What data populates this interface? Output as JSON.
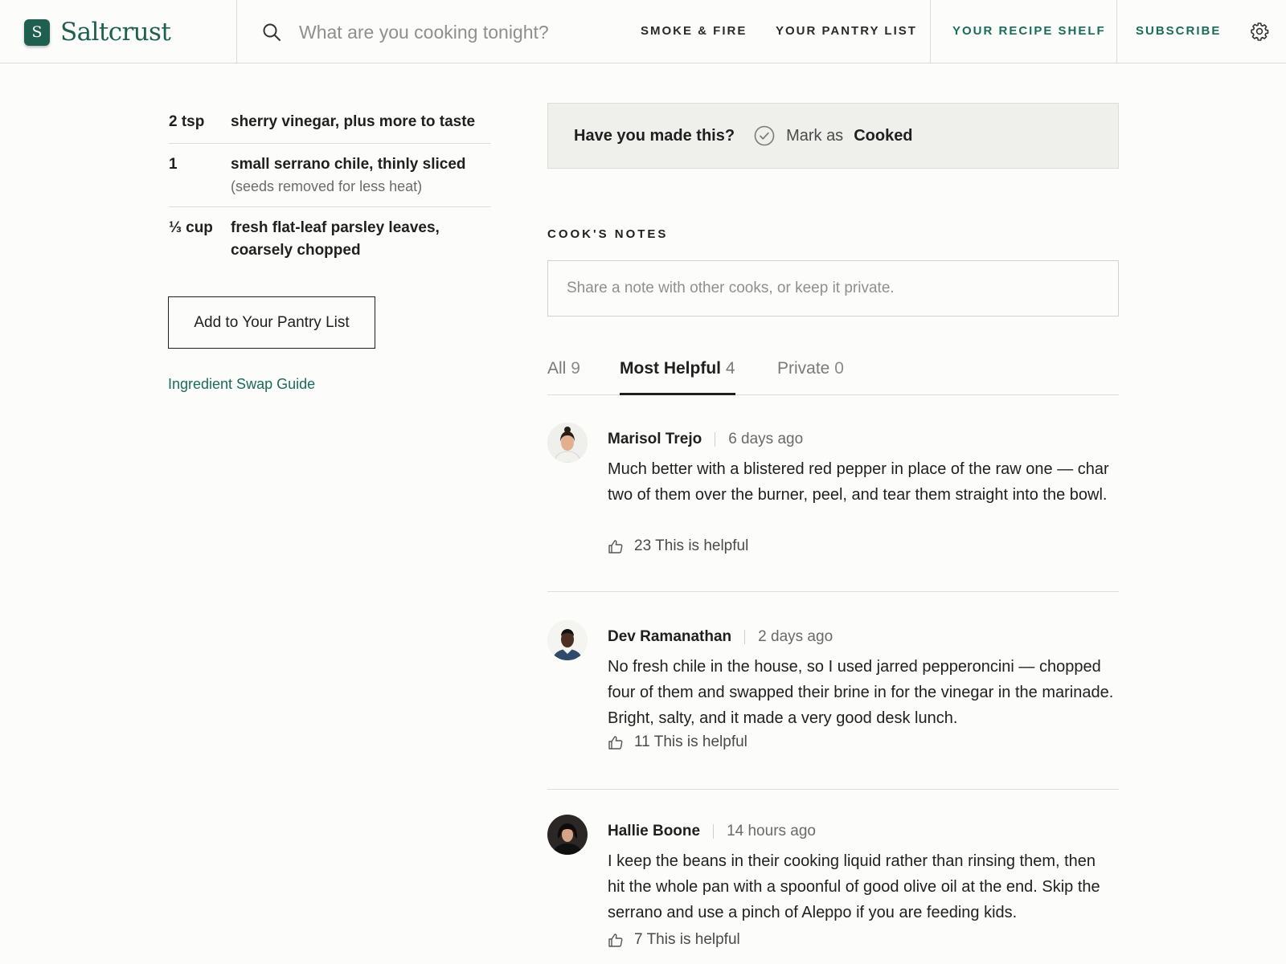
{
  "header": {
    "logo_letter": "S",
    "logo_text": "Saltcrust",
    "search_placeholder": "What are you cooking tonight?",
    "nav": [
      {
        "label": "SMOKE & FIRE"
      },
      {
        "label": "YOUR PANTRY LIST"
      },
      {
        "label": "YOUR RECIPE SHELF"
      },
      {
        "label": "SUBSCRIBE"
      }
    ],
    "settings_icon": "gear-icon"
  },
  "ingredients": [
    {
      "qty": "2 tsp",
      "name": "sherry vinegar, plus more to taste",
      "note": ""
    },
    {
      "qty": "1",
      "name": "small serrano chile, thinly sliced",
      "note": "(seeds removed for less heat)"
    },
    {
      "qty": "⅓ cup",
      "name": "fresh flat-leaf parsley leaves, coarsely chopped",
      "note": ""
    }
  ],
  "actions": {
    "pantry_button": "Add to Your Pantry List",
    "swap_link": "Ingredient Swap Guide"
  },
  "made_this": {
    "question": "Have you made this?",
    "mark_as": "Mark as",
    "cooked": "Cooked"
  },
  "notes": {
    "title": "COOK'S NOTES",
    "placeholder": "Share a note with other cooks, or keep it private.",
    "tabs": [
      {
        "label": "All",
        "count": "9"
      },
      {
        "label": "Most Helpful",
        "count": "4"
      },
      {
        "label": "Private",
        "count": "0"
      }
    ],
    "active_tab": "Most Helpful",
    "comments": [
      {
        "author": "Marisol Trejo",
        "time": "6 days ago",
        "body": "Much better with a blistered red pepper in place of the raw one — char two of them over the burner, peel, and tear them straight into the bowl.",
        "helpful_count": "23",
        "helpful_label": "This is helpful"
      },
      {
        "author": "Dev Ramanathan",
        "time": "2 days ago",
        "body": "No fresh chile in the house, so I used jarred pepperoncini — chopped four of them and swapped their brine in for the vinegar in the marinade. Bright, salty, and it made a very good desk lunch.",
        "helpful_count": "11",
        "helpful_label": "This is helpful"
      },
      {
        "author": "Hallie Boone",
        "time": "14 hours ago",
        "body": "I keep the beans in their cooking liquid rather than rinsing them, then hit the whole pan with a spoonful of good olive oil at the end. Skip the serrano and use a pinch of Aleppo if you are feeding kids.",
        "helpful_count": "7",
        "helpful_label": "This is helpful"
      }
    ]
  },
  "colors": {
    "brand": "#1f5f4f",
    "accent_link": "#1a6b59",
    "panel_bg": "#efefec",
    "divider": "#dcdcd8"
  }
}
